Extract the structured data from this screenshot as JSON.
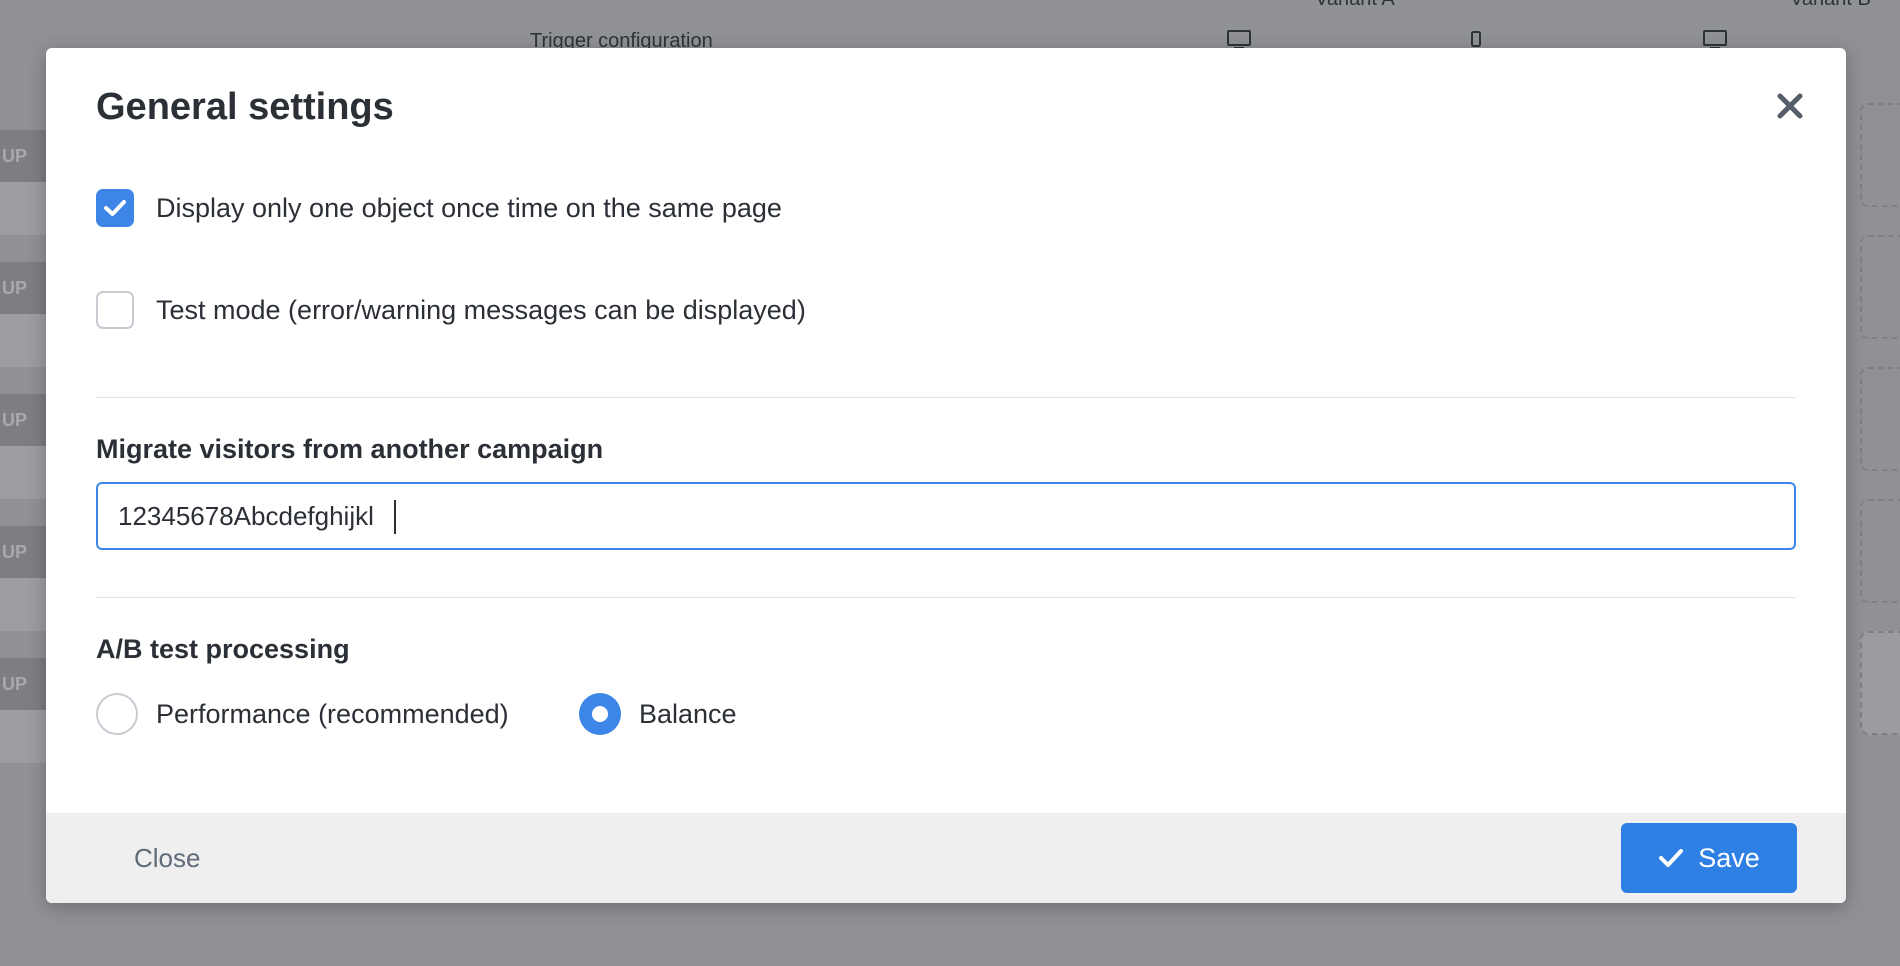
{
  "background": {
    "header_text": "Trigger configuration",
    "variant_a_label": "Variant A",
    "variant_b_label": "Variant B",
    "pill_label": "UP"
  },
  "modal": {
    "title": "General settings",
    "options": {
      "single_object_label": "Display only one object once time on the same page",
      "single_object_checked": true,
      "test_mode_label": "Test mode (error/warning messages can be displayed)",
      "test_mode_checked": false
    },
    "migrate": {
      "label": "Migrate visitors from another campaign",
      "value": "12345678Abcdefghijkl"
    },
    "ab_test": {
      "label": "A/B test processing",
      "options": [
        {
          "label": "Performance (recommended)",
          "selected": false
        },
        {
          "label": "Balance",
          "selected": true
        }
      ]
    },
    "footer": {
      "close_label": "Close",
      "save_label": "Save"
    }
  },
  "colors": {
    "accent": "#3d86e8",
    "overlay": "#8f9196",
    "footer_bg": "#efefef"
  }
}
